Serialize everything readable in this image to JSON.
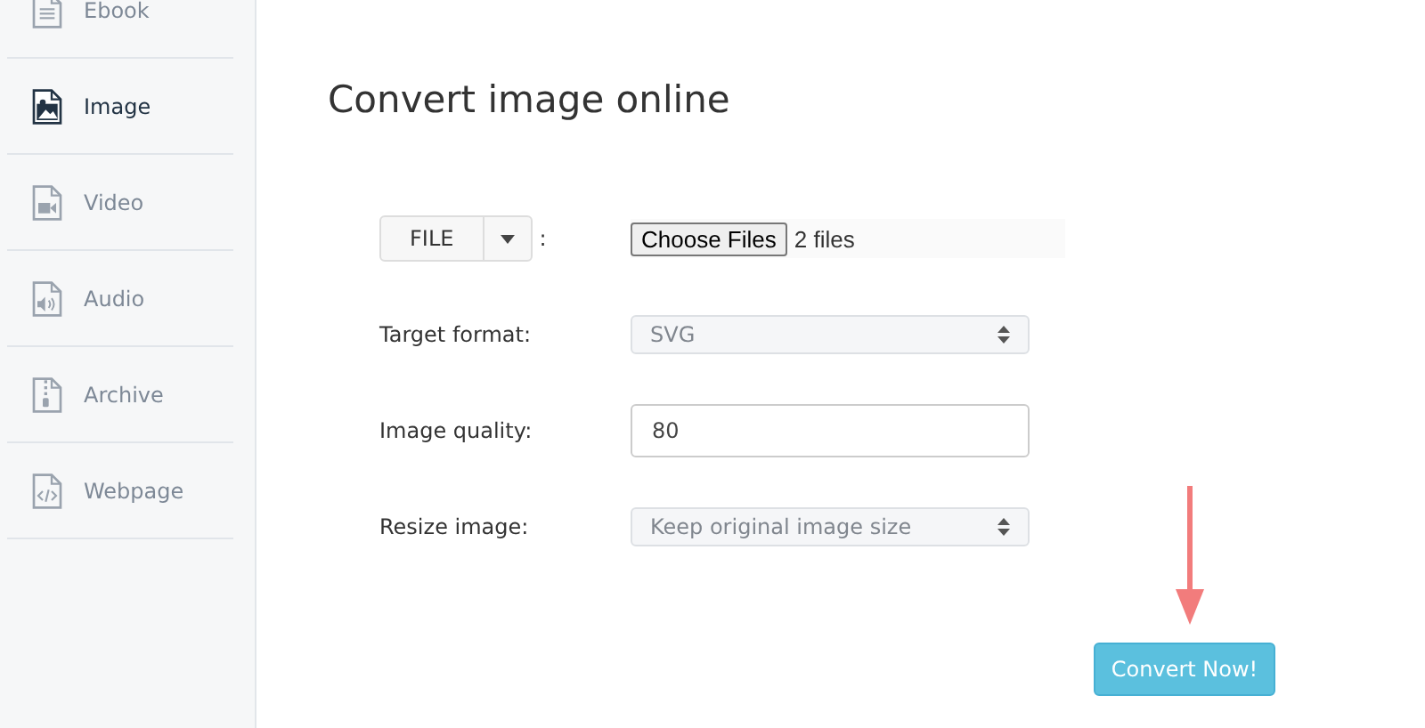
{
  "sidebar": {
    "items": [
      {
        "label": "Ebook",
        "selected": false
      },
      {
        "label": "Image",
        "selected": true
      },
      {
        "label": "Video",
        "selected": false
      },
      {
        "label": "Audio",
        "selected": false
      },
      {
        "label": "Archive",
        "selected": false
      },
      {
        "label": "Webpage",
        "selected": false
      }
    ]
  },
  "title": "Convert image online",
  "source": {
    "button": "FILE",
    "separator": ":",
    "choose_button": "Choose Files",
    "file_count": "2 files"
  },
  "fields": [
    {
      "kind": "select",
      "label": "Target format:",
      "value": "SVG"
    },
    {
      "kind": "input",
      "label": "Image quality:",
      "value": "80"
    },
    {
      "kind": "select",
      "label": "Resize image:",
      "value": "Keep original image size"
    }
  ],
  "convert_button": "Convert Now!"
}
